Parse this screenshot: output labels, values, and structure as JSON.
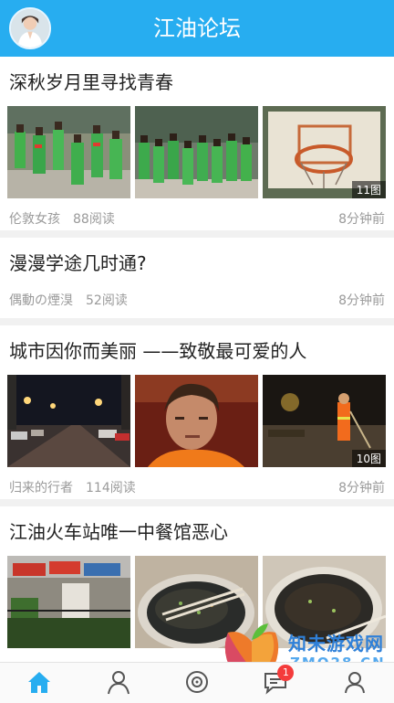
{
  "header": {
    "title": "江油论坛"
  },
  "posts": [
    {
      "title": "深秋岁月里寻找青春",
      "author": "伦敦女孩",
      "reads": "88阅读",
      "time": "8分钟前",
      "image_count": "11图"
    },
    {
      "title": "漫漫学途几时通?",
      "author": "偶動の煙湨",
      "reads": "52阅读",
      "time": "8分钟前"
    },
    {
      "title": "城市因你而美丽 ——致敬最可爱的人",
      "author": "归来的行者",
      "reads": "114阅读",
      "time": "8分钟前",
      "image_count": "10图"
    },
    {
      "title": "江油火车站唯一中餐馆恶心"
    }
  ],
  "tabbar": {
    "items": [
      {
        "icon": "home-icon",
        "active": true
      },
      {
        "icon": "user-icon"
      },
      {
        "icon": "discover-icon"
      },
      {
        "icon": "message-icon",
        "badge": "1"
      },
      {
        "icon": "profile-icon"
      }
    ]
  },
  "watermark": {
    "text": "知未游戏网",
    "domain": "ZMO28.CN"
  },
  "colors": {
    "header": "#27adf0",
    "active_tab": "#27adf0",
    "badge": "#f43b3b"
  }
}
